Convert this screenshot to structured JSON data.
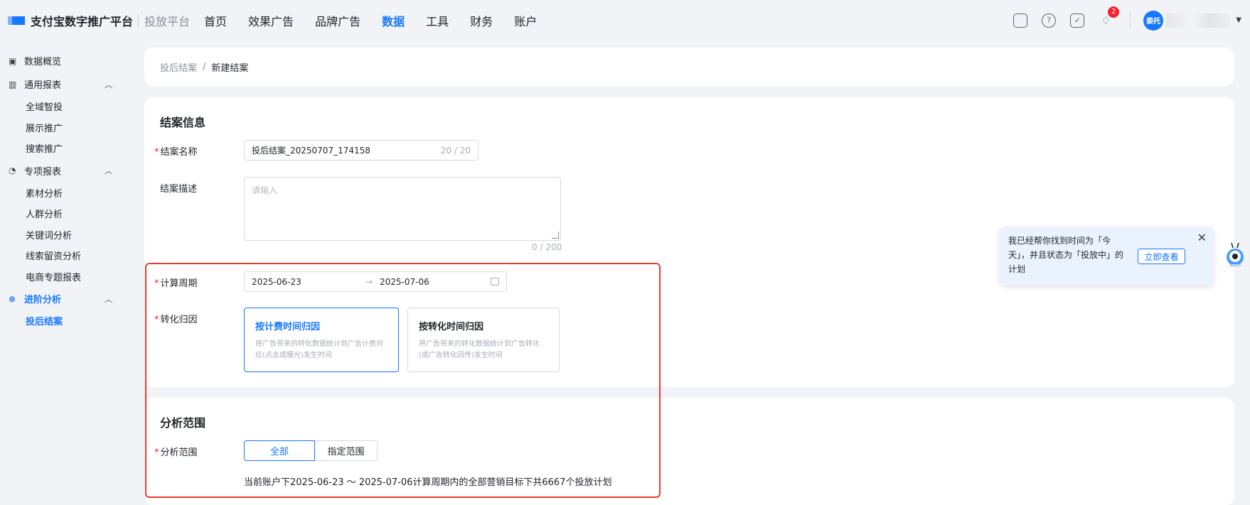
{
  "header": {
    "brand": "支付宝数字推广平台",
    "product": "投放平台",
    "nav": [
      "首页",
      "效果广告",
      "品牌广告",
      "数据",
      "工具",
      "财务",
      "账户"
    ],
    "active_nav": "数据",
    "notification_count": "2",
    "avatar_text": "委托"
  },
  "sidebar": {
    "overview": "数据概览",
    "group1": {
      "label": "通用报表",
      "items": [
        "全域智投",
        "展示推广",
        "搜索推广"
      ]
    },
    "group2": {
      "label": "专项报表",
      "items": [
        "素材分析",
        "人群分析",
        "关键词分析",
        "线索留资分析",
        "电商专题报表"
      ]
    },
    "group3": {
      "label": "进阶分析",
      "items": [
        "投后结案"
      ]
    }
  },
  "breadcrumb": {
    "parent": "投后结案",
    "sep": "/",
    "current": "新建结案"
  },
  "form": {
    "section_title": "结案信息",
    "name_label": "结案名称",
    "name_value": "投后结案_20250707_174158",
    "name_count": "20 / 20",
    "desc_label": "结案描述",
    "desc_placeholder": "请输入",
    "desc_count": "0 / 200",
    "period_label": "计算周期",
    "period_start": "2025-06-23",
    "period_arrow": "→",
    "period_end": "2025-07-06",
    "attr_label": "转化归因",
    "attr_options": [
      {
        "title": "按计费时间归因",
        "desc": "将广告带来的转化数据统计到广告计费对应(点击或曝光)发生时间"
      },
      {
        "title": "按转化时间归因",
        "desc": "将广告带来的转化数据统计到广告转化(或广告转化回传)发生时间"
      }
    ]
  },
  "range": {
    "section_title": "分析范围",
    "label": "分析范围",
    "options": [
      "全部",
      "指定范围"
    ],
    "note": "当前账户下2025-06-23 ～ 2025-07-06计算周期内的全部营销目标下共6667个投放计划"
  },
  "popup": {
    "text": "我已经帮你找到时间为「今天」，并且状态为「投放中」的计划",
    "button": "立即查看",
    "close": "✕"
  },
  "colors": {
    "accent": "#1677ff",
    "highlight_box": "#e53d2f",
    "required": "#f5222d"
  }
}
